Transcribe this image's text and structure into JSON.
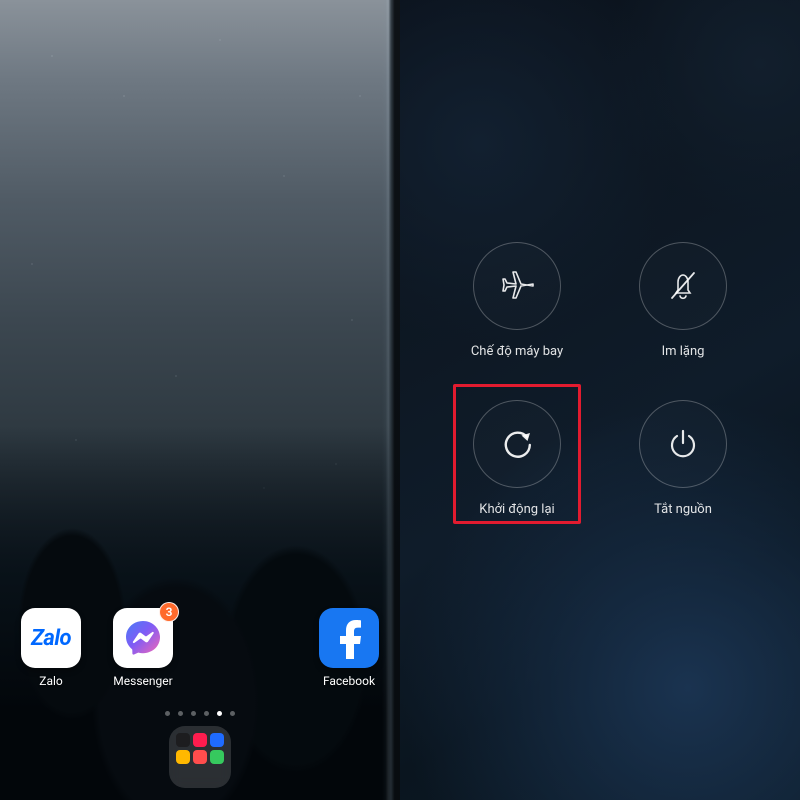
{
  "home": {
    "apps": [
      {
        "name": "zalo",
        "label": "Zalo",
        "badge": null
      },
      {
        "name": "messenger",
        "label": "Messenger",
        "badge": "3"
      },
      {
        "name": "facebook",
        "label": "Facebook",
        "badge": null
      }
    ],
    "page_indicator": {
      "count": 6,
      "active_index": 4
    },
    "dock_folder": {
      "name": "folder"
    }
  },
  "power_menu": {
    "items": [
      {
        "key": "airplane",
        "label": "Chế độ máy bay",
        "icon": "airplane-icon"
      },
      {
        "key": "silent",
        "label": "Im lặng",
        "icon": "bell-off-icon"
      },
      {
        "key": "restart",
        "label": "Khởi động lại",
        "icon": "restart-icon",
        "highlighted": true
      },
      {
        "key": "power-off",
        "label": "Tắt nguồn",
        "icon": "power-icon"
      }
    ],
    "highlight_color": "#e21b2f"
  }
}
